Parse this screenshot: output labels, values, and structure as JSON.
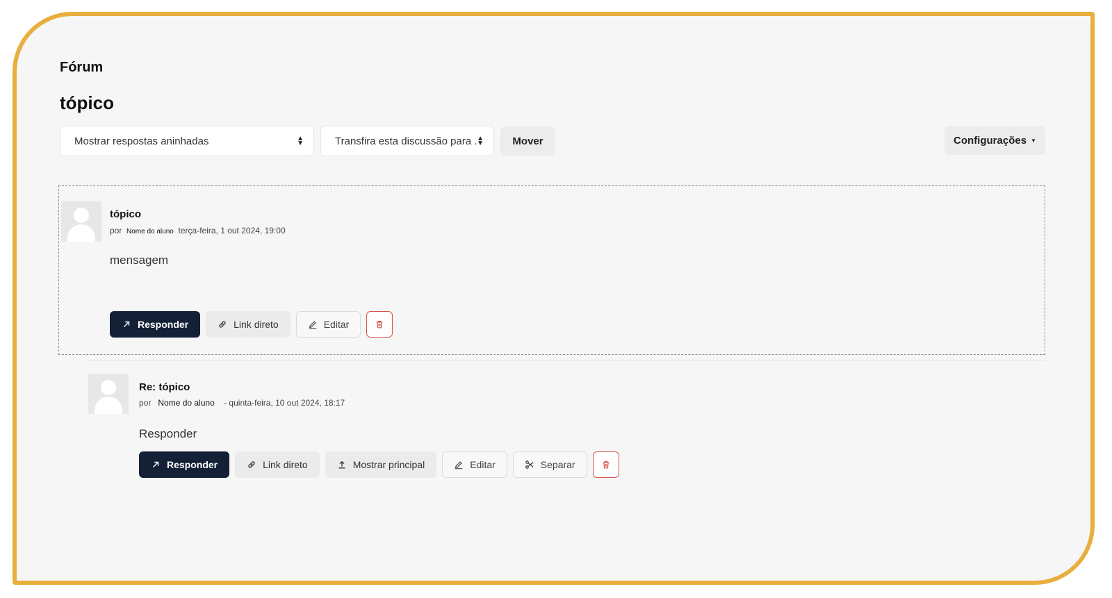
{
  "breadcrumb": "Fórum",
  "page_title": "tópico",
  "toolbar": {
    "display_mode": "Mostrar respostas aninhadas",
    "move_target": "Transfira esta discussão para .",
    "move_label": "Mover",
    "settings_label": "Configurações"
  },
  "post1": {
    "title": "tópico",
    "by": "por",
    "author": "Nome do aluno",
    "date": "terça-feira, 1 out 2024, 19:00",
    "body": "mensagem",
    "actions": {
      "reply": "Responder",
      "permalink": "Link direto",
      "edit": "Editar"
    }
  },
  "post2": {
    "title": "Re: tópico",
    "by": "por",
    "author": "Nome do aluno",
    "date": "- quinta-feira, 10 out 2024, 18:17",
    "body": "Responder",
    "actions": {
      "reply": "Responder",
      "permalink": "Link direto",
      "show_parent": "Mostrar principal",
      "edit": "Editar",
      "split": "Separar"
    }
  },
  "colors": {
    "frame": "#e8ae3e",
    "primary_button": "#132036",
    "danger": "#d9534f"
  },
  "icons": [
    "arrow-up-right-icon",
    "link-icon",
    "pencil-icon",
    "trash-icon",
    "upload-icon",
    "scissors-icon",
    "chevron-updown-icon",
    "caret-down-icon",
    "user-avatar-icon"
  ]
}
